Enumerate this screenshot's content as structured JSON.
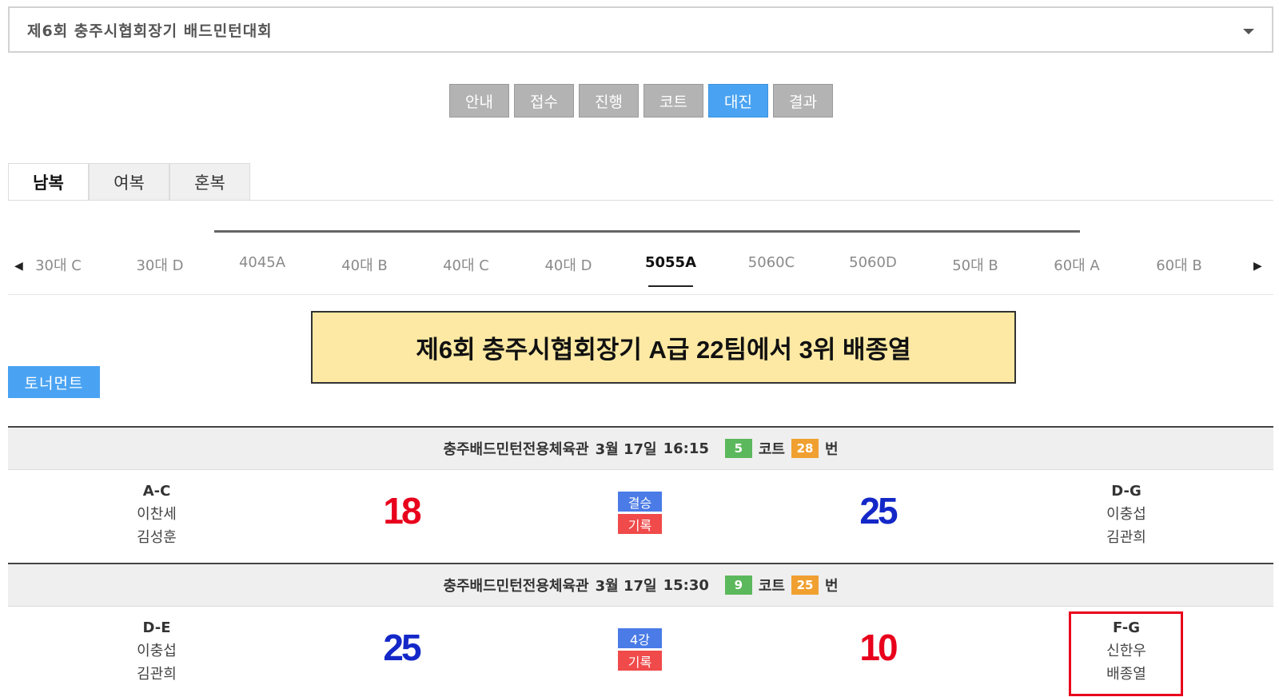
{
  "tournament_select": {
    "value": "제6회 충주시협회장기 배드민턴대회"
  },
  "main_nav": [
    {
      "label": "안내",
      "active": false
    },
    {
      "label": "접수",
      "active": false
    },
    {
      "label": "진행",
      "active": false
    },
    {
      "label": "코트",
      "active": false
    },
    {
      "label": "대진",
      "active": true
    },
    {
      "label": "결과",
      "active": false
    }
  ],
  "event_tabs": [
    {
      "label": "남복",
      "active": true
    },
    {
      "label": "여복",
      "active": false
    },
    {
      "label": "혼복",
      "active": false
    }
  ],
  "categories": [
    {
      "label": "30대 C",
      "active": false
    },
    {
      "label": "30대 D",
      "active": false
    },
    {
      "label": "4045A",
      "active": false
    },
    {
      "label": "40대 B",
      "active": false
    },
    {
      "label": "40대 C",
      "active": false
    },
    {
      "label": "40대 D",
      "active": false
    },
    {
      "label": "5055A",
      "active": true
    },
    {
      "label": "5060C",
      "active": false
    },
    {
      "label": "5060D",
      "active": false
    },
    {
      "label": "50대 B",
      "active": false
    },
    {
      "label": "60대 A",
      "active": false
    },
    {
      "label": "60대 B",
      "active": false
    }
  ],
  "icons": {
    "prev": "triangle-left-icon",
    "next": "triangle-right-icon",
    "dropdown": "caret-down-icon"
  },
  "annotation": "제6회 충주시협회장기 A급 22팀에서 3위 배종열",
  "tournament_button": "토너먼트",
  "labels": {
    "court": "코트",
    "number": "번"
  },
  "matches": [
    {
      "venue": "충주배드민턴전용체육관",
      "date": "3월 17일",
      "time": "16:15",
      "court": "5",
      "number": "28",
      "left": {
        "team": "A-C",
        "players": [
          "이찬세",
          "김성훈"
        ],
        "score": "18"
      },
      "right": {
        "team": "D-G",
        "players": [
          "이충섭",
          "김관희"
        ],
        "score": "25"
      },
      "round": "결승",
      "record": "기록"
    },
    {
      "venue": "충주배드민턴전용체육관",
      "date": "3월 17일",
      "time": "15:30",
      "court": "9",
      "number": "25",
      "left": {
        "team": "D-E",
        "players": [
          "이충섭",
          "김관희"
        ],
        "score": "25"
      },
      "right": {
        "team": "F-G",
        "players": [
          "신한우",
          "배종열"
        ],
        "score": "10"
      },
      "round": "4강",
      "record": "기록"
    }
  ],
  "colors": {
    "accent": "#4aa3f2",
    "score_red": "#e8001c",
    "score_blue": "#1428c8",
    "highlight": "#e8001c",
    "annotation_bg": "#fde9a3"
  }
}
